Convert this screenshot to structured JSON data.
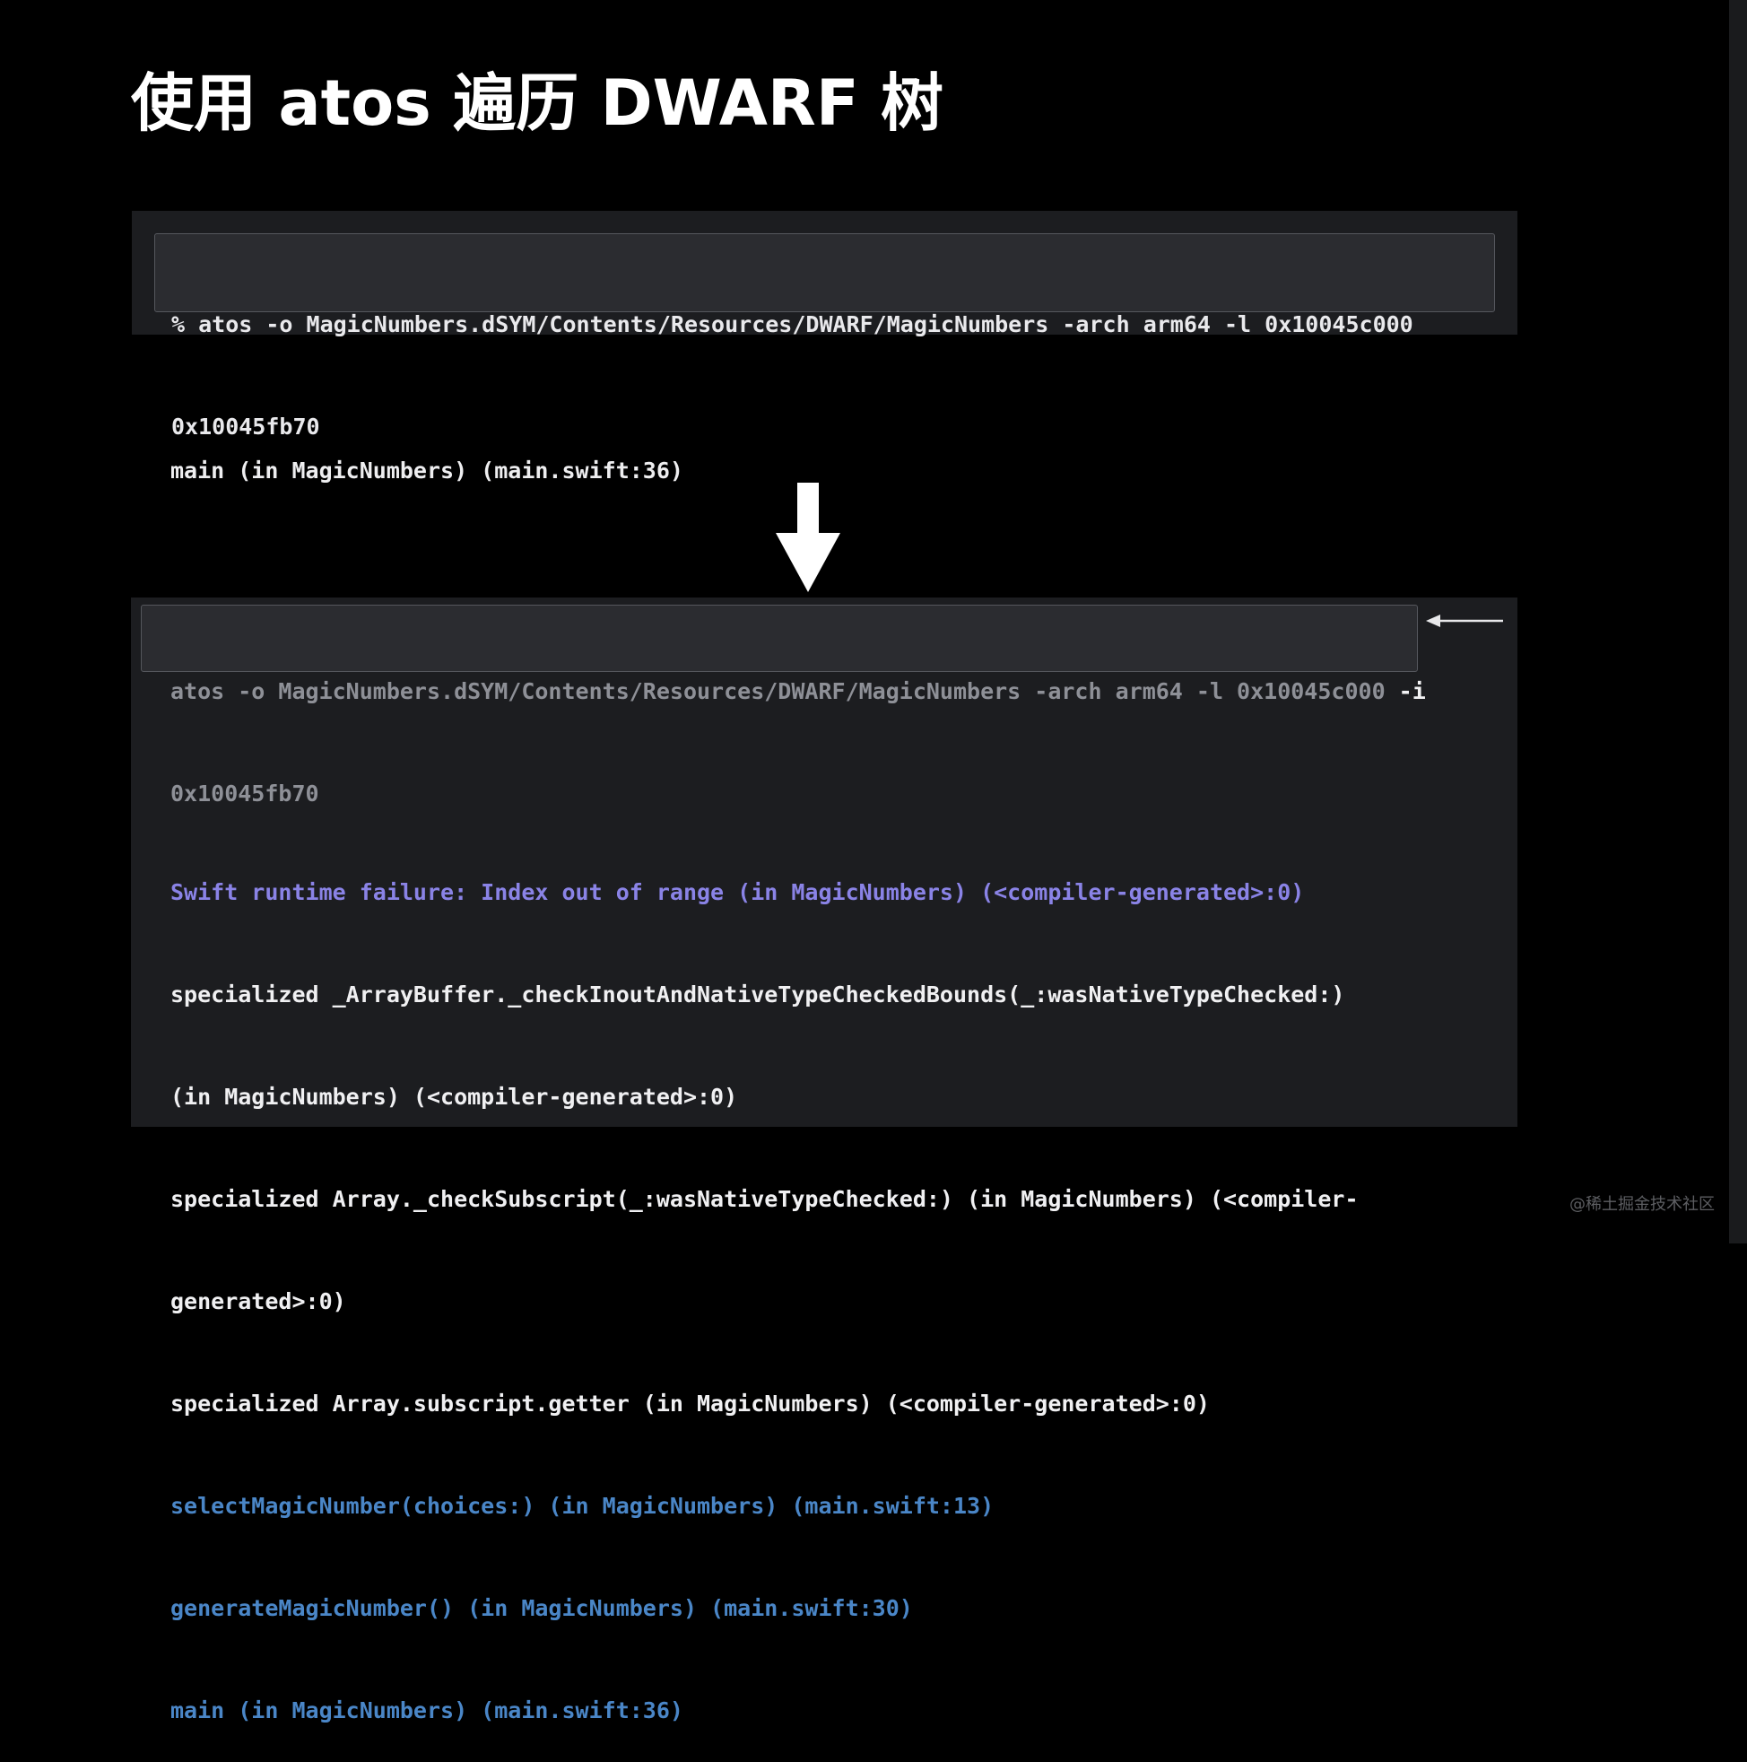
{
  "slide": {
    "title": "使用 atos 遍历 DWARF 树"
  },
  "top_command": {
    "line1": "% atos -o MagicNumbers.dSYM/Contents/Resources/DWARF/MagicNumbers -arch arm64 -l 0x10045c000",
    "line2": "0x10045fb70"
  },
  "basic_output": {
    "text": "main (in MagicNumbers) (main.swift:36)"
  },
  "inline_command": {
    "line1": "atos -o MagicNumbers.dSYM/Contents/Resources/DWARF/MagicNumbers -arch arm64 -l 0x10045c000 ",
    "flag": "-i",
    "line2": "0x10045fb70"
  },
  "inline_output": {
    "lines": [
      "Swift runtime failure: Index out of range (in MagicNumbers) (<compiler-generated>:0)",
      "specialized _ArrayBuffer._checkInoutAndNativeTypeCheckedBounds(_:wasNativeTypeChecked:)",
      "(in MagicNumbers) (<compiler-generated>:0)",
      "specialized Array._checkSubscript(_:wasNativeTypeChecked:) (in MagicNumbers) (<compiler-",
      "generated>:0)",
      "specialized Array.subscript.getter (in MagicNumbers) (<compiler-generated>:0)",
      "selectMagicNumber(choices:) (in MagicNumbers) (main.swift:13)",
      "generateMagicNumber() (in MagicNumbers) (main.swift:30)",
      "main (in MagicNumbers) (main.swift:36)"
    ]
  },
  "icons": {
    "down_arrow": "down-arrow-icon",
    "left_arrow": "left-arrow-icon"
  },
  "colors": {
    "background": "#000000",
    "panel": "#1c1d20",
    "runtime_failure": "#8a83e6",
    "specialized_frames": "#f0f0f2",
    "user_frames": "#4a86c7"
  },
  "watermark": {
    "text": "@稀土掘金技术社区"
  }
}
